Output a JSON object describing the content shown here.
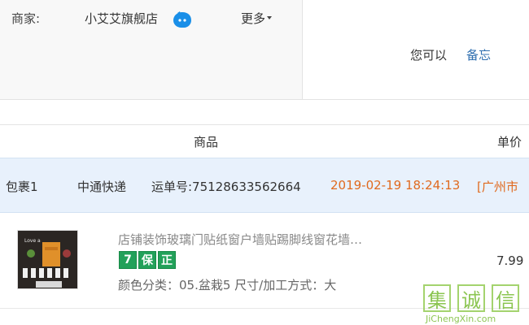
{
  "shop": {
    "label": "商家:",
    "name": "小艾艾旗舰店",
    "more": "更多"
  },
  "actions": {
    "you_can": "您可以",
    "memo": "备忘"
  },
  "table_header": {
    "goods": "商品",
    "price": "单价"
  },
  "package": {
    "name": "包裹1",
    "carrier": "中通快递",
    "waybill": "运单号:75128633562664",
    "time": "2019-02-19 18:24:13",
    "city": "[广州市"
  },
  "item": {
    "title": "店铺装饰玻璃门贴纸窗户墙贴踢脚线窗花墙…",
    "badges": [
      "7",
      "保",
      "正"
    ],
    "sku": "颜色分类：05.盆栽5 尺寸/加工方式：大",
    "price": "7.99",
    "thumb_caption": "Love a"
  },
  "watermark": {
    "chars": [
      "集",
      "诚",
      "信"
    ],
    "url": "JiChengXin.com"
  },
  "colors": {
    "link_blue": "#2f6fb0",
    "time_orange": "#e06a1f",
    "badge_green": "#23a15a",
    "package_bg": "#e8f1fc"
  }
}
